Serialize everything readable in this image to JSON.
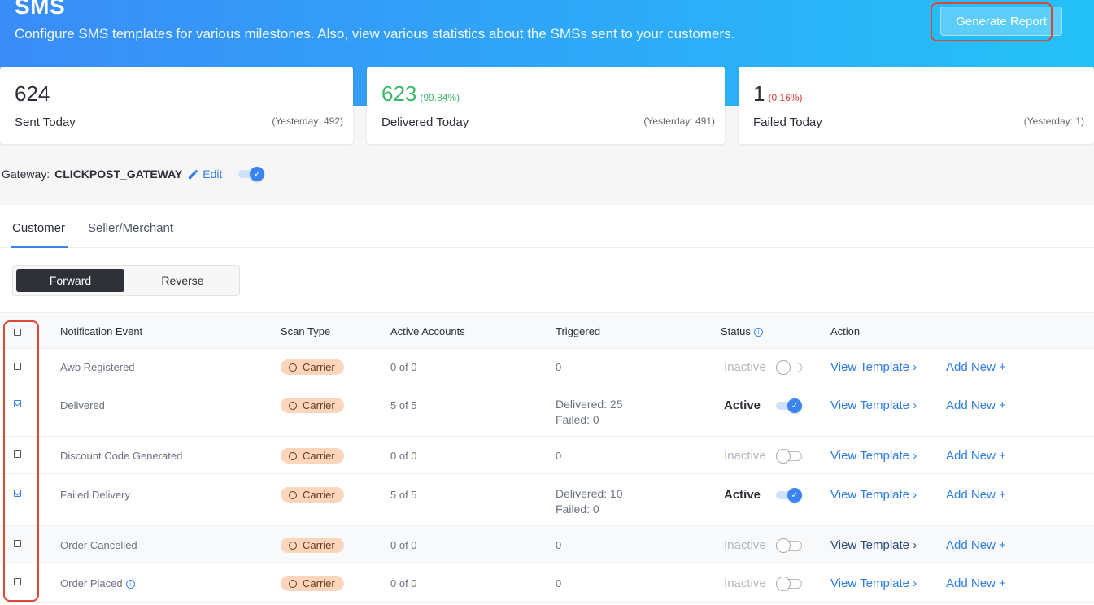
{
  "header": {
    "title": "SMS",
    "subtitle": "Configure SMS templates for various milestones. Also, view various statistics about the SMSs sent to your customers.",
    "generate_report_label": "Generate Report"
  },
  "stats": [
    {
      "value": "624",
      "percent": "",
      "label": "Sent Today",
      "yesterday": "(Yesterday: 492)"
    },
    {
      "value": "623",
      "percent": "(99.84%)",
      "label": "Delivered Today",
      "yesterday": "(Yesterday: 491)"
    },
    {
      "value": "1",
      "percent": "(0.16%)",
      "label": "Failed Today",
      "yesterday": "(Yesterday: 1)"
    }
  ],
  "gateway": {
    "label": "Gateway:",
    "name": "CLICKPOST_GATEWAY",
    "edit_label": "Edit",
    "enabled": true
  },
  "tabs": [
    {
      "label": "Customer",
      "active": true
    },
    {
      "label": "Seller/Merchant",
      "active": false
    }
  ],
  "direction": {
    "options": [
      "Forward",
      "Reverse"
    ],
    "selected": "Forward"
  },
  "table": {
    "columns": [
      "Notification Event",
      "Scan Type",
      "Active Accounts",
      "Triggered",
      "Status",
      "Action"
    ],
    "rows": [
      {
        "event": "Awb Registered",
        "scan": "Carrier",
        "accounts": "0 of 0",
        "triggered": [
          "0"
        ],
        "status": "Inactive",
        "active": false,
        "checked": false,
        "view": "View Template",
        "add": "Add New"
      },
      {
        "event": "Delivered",
        "scan": "Carrier",
        "accounts": "5 of 5",
        "triggered": [
          "Delivered: 25",
          "Failed: 0"
        ],
        "status": "Active",
        "active": true,
        "checked": true,
        "view": "View Template",
        "add": "Add New"
      },
      {
        "event": "Discount Code Generated",
        "scan": "Carrier",
        "accounts": "0 of 0",
        "triggered": [
          "0"
        ],
        "status": "Inactive",
        "active": false,
        "checked": false,
        "view": "View Template",
        "add": "Add New"
      },
      {
        "event": "Failed Delivery",
        "scan": "Carrier",
        "accounts": "5 of 5",
        "triggered": [
          "Delivered: 10",
          "Failed: 0"
        ],
        "status": "Active",
        "active": true,
        "checked": true,
        "view": "View Template",
        "add": "Add New"
      },
      {
        "event": "Order Cancelled",
        "scan": "Carrier",
        "accounts": "0 of 0",
        "triggered": [
          "0"
        ],
        "status": "Inactive",
        "active": false,
        "checked": false,
        "view": "View Template",
        "add": "Add New"
      },
      {
        "event": "Order Placed",
        "scan": "Carrier",
        "accounts": "0 of 0",
        "triggered": [
          "0"
        ],
        "status": "Inactive",
        "active": false,
        "checked": false,
        "view": "View Template",
        "add": "Add New"
      }
    ]
  },
  "icons": {
    "edit": "pencil-icon",
    "info": "info-icon",
    "chevron": "chevron-right-icon",
    "plus": "plus-icon",
    "check": "check-icon"
  },
  "colors": {
    "accent": "#3a84f2",
    "delivered_green": "#3cb86a",
    "failed_red": "#e0353b",
    "chip_bg": "#fbd6bd",
    "highlight": "#d9483b"
  }
}
